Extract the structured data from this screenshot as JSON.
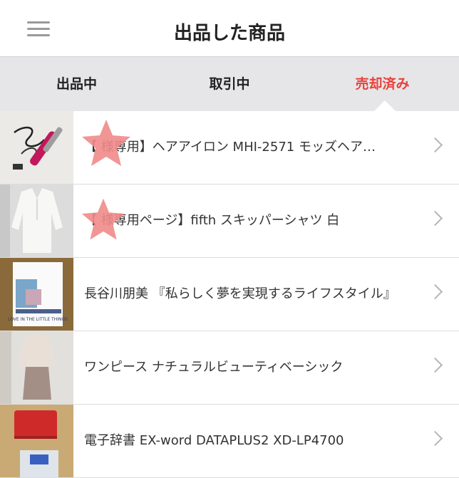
{
  "header": {
    "title": "出品した商品",
    "menu_icon": "hamburger-menu-icon"
  },
  "tabs": [
    {
      "label": "出品中",
      "active": false
    },
    {
      "label": "取引中",
      "active": false
    },
    {
      "label": "売却済み",
      "active": true
    }
  ],
  "colors": {
    "accent": "#e8413a",
    "tab_bar": "#e6e6e8",
    "redaction": "#f08a8a"
  },
  "items": [
    {
      "title": "【 様専用】ヘアアイロン MHI-2571 モッズヘア…",
      "thumb": "hair-iron-photo"
    },
    {
      "title": "【 様専用ページ】fifth  スキッパーシャツ 白",
      "thumb": "white-shirt-photo"
    },
    {
      "title": "長谷川朋美 『私らしく夢を実現するライフスタイル』",
      "thumb": "book-photo"
    },
    {
      "title": "ワンピース ナチュラルビューティベーシック",
      "thumb": "dress-photo"
    },
    {
      "title": "電子辞書 EX-word DATAPLUS2  XD-LP4700",
      "thumb": "electronic-dictionary-photo"
    }
  ],
  "book_cover_text": "LOVE IN THE LITTLE THINGS"
}
